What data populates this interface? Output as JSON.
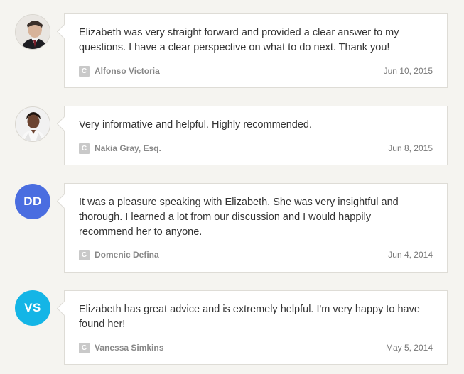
{
  "colors": {
    "page_background": "#f5f4f0",
    "card_background": "#ffffff",
    "card_border": "#dedcd6",
    "text": "#333333",
    "meta_text": "#888888",
    "client_badge": "#c9c9c9",
    "avatar_dd": "#4a6de0",
    "avatar_vs": "#14b5e6"
  },
  "reviews": [
    {
      "avatar_type": "photo",
      "avatar_icon": "man-in-suit-portrait",
      "text": "Elizabeth was very straight forward and provided a clear answer to my questions. I have a clear perspective on what to do next. Thank you!",
      "badge": "C",
      "author": "Alfonso Victoria",
      "date": "Jun 10, 2015"
    },
    {
      "avatar_type": "photo",
      "avatar_icon": "woman-portrait",
      "text": "Very informative and helpful. Highly recommended.",
      "badge": "C",
      "author": "Nakia Gray, Esq.",
      "date": "Jun 8, 2015"
    },
    {
      "avatar_type": "initials",
      "initials": "DD",
      "text": "It was a pleasure speaking with Elizabeth. She was very insightful and thorough. I learned a lot from our discussion and I would happily recommend her to anyone.",
      "badge": "C",
      "author": "Domenic Defina",
      "date": "Jun 4, 2014"
    },
    {
      "avatar_type": "initials",
      "initials": "VS",
      "text": "Elizabeth has great advice and is extremely helpful. I'm very happy to have found her!",
      "badge": "C",
      "author": "Vanessa Simkins",
      "date": "May 5, 2014"
    }
  ]
}
